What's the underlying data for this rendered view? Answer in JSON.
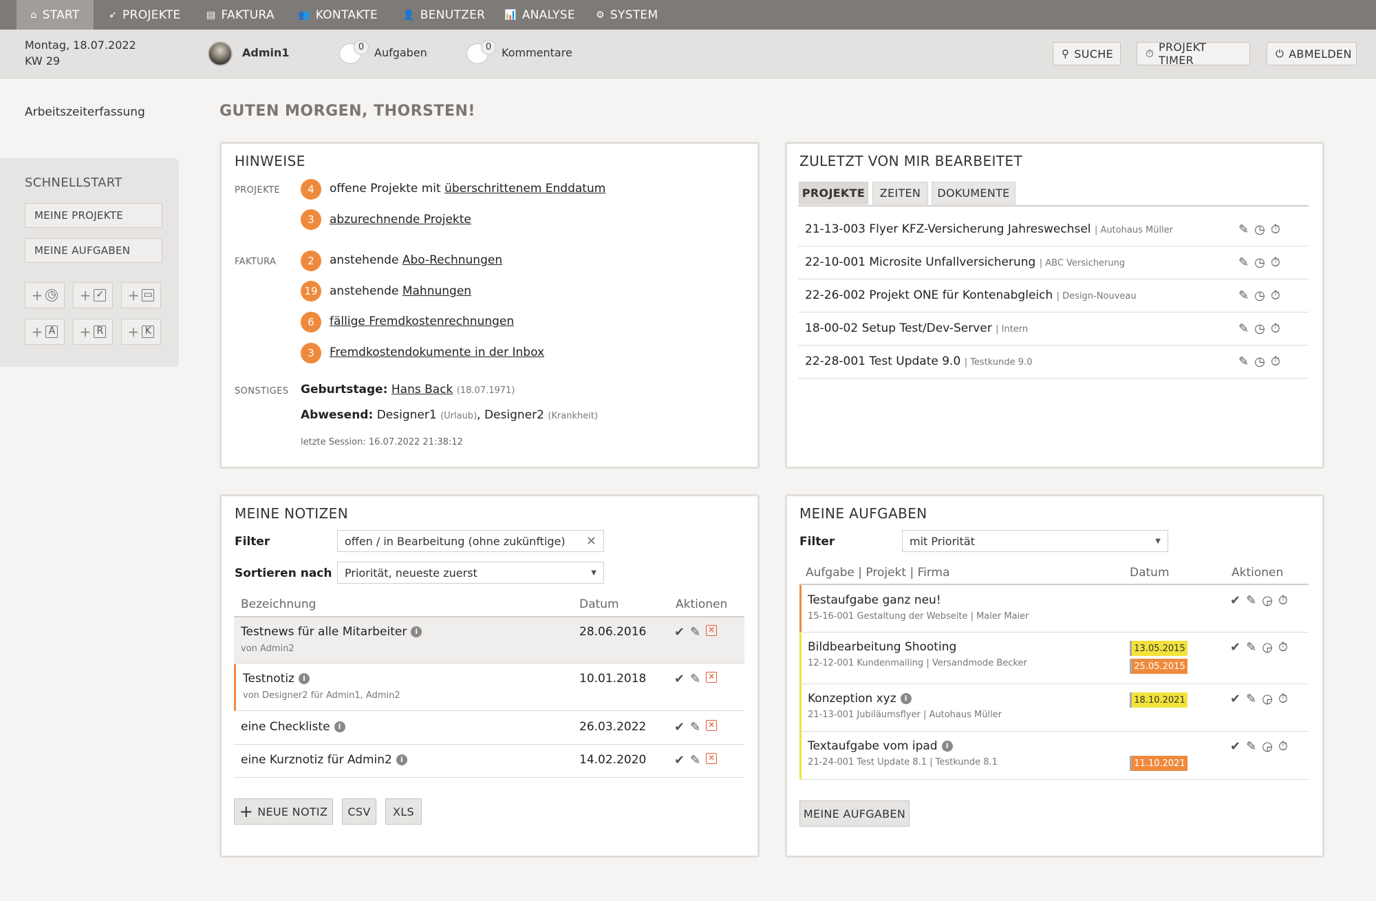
{
  "nav": {
    "items": [
      {
        "label": "START",
        "icon": "home-icon"
      },
      {
        "label": "PROJEKTE",
        "icon": "rocket-icon"
      },
      {
        "label": "FAKTURA",
        "icon": "invoice-icon"
      },
      {
        "label": "KONTAKTE",
        "icon": "people-icon"
      },
      {
        "label": "BENUTZER",
        "icon": "user-icon"
      },
      {
        "label": "ANALYSE",
        "icon": "chart-icon"
      },
      {
        "label": "SYSTEM",
        "icon": "gear-icon"
      }
    ],
    "active": "START"
  },
  "header": {
    "date": "Montag, 18.07.2022",
    "week": "KW 29",
    "user": "Admin1",
    "tasks": {
      "count": "0",
      "label": "Aufgaben"
    },
    "comments": {
      "count": "0",
      "label": "Kommentare"
    },
    "search_label": "SUCHE",
    "timer_label": "PROJEKT TIMER",
    "logout_label": "ABMELDEN"
  },
  "sidebar": {
    "link": "Arbeitszeiterfassung",
    "quickstart_title": "SCHNELLSTART",
    "my_projects": "MEINE PROJEKTE",
    "my_tasks": "MEINE AUFGABEN",
    "quick_icons": [
      {
        "name": "add-time-icon",
        "sym": "🕑"
      },
      {
        "name": "add-task-icon",
        "sym": "☑"
      },
      {
        "name": "add-folder-icon",
        "sym": "🗀"
      },
      {
        "name": "add-a-icon",
        "sym": "A"
      },
      {
        "name": "add-r-icon",
        "sym": "R"
      },
      {
        "name": "add-k-icon",
        "sym": "K"
      }
    ]
  },
  "greeting": "GUTEN MORGEN, THORSTEN!",
  "hinweise": {
    "title": "HINWEISE",
    "projekte_label": "PROJEKTE",
    "faktura_label": "FAKTURA",
    "sonstiges_label": "SONSTIGES",
    "items": [
      {
        "count": "4",
        "pre": "offene Projekte mit ",
        "link": "überschrittenem Enddatum"
      },
      {
        "count": "3",
        "pre": "",
        "link": "abzurechnende Projekte"
      },
      {
        "count": "2",
        "pre": "anstehende ",
        "link": "Abo-Rechnungen"
      },
      {
        "count": "19",
        "pre": "anstehende ",
        "link": "Mahnungen"
      },
      {
        "count": "6",
        "pre": "",
        "link": "fällige Fremdkostenrechnungen"
      },
      {
        "count": "3",
        "pre": "",
        "link": "Fremdkostendokumente in der Inbox"
      }
    ],
    "birthday_label": "Geburtstage:",
    "birthday_name": "Hans Back",
    "birthday_date": "(18.07.1971)",
    "absent_label": "Abwesend:",
    "absent_1": "Designer1",
    "absent_1_reason": "(Urlaub)",
    "absent_2": "Designer2",
    "absent_2_reason": "(Krankheit)",
    "last_session": "letzte Session: 16.07.2022 21:38:12"
  },
  "recent": {
    "title": "ZULETZT VON MIR BEARBEITET",
    "tabs": [
      "PROJEKTE",
      "ZEITEN",
      "DOKUMENTE"
    ],
    "rows": [
      {
        "name": "21-13-003 Flyer KFZ-Versicherung Jahreswechsel",
        "client": "| Autohaus Müller"
      },
      {
        "name": "22-10-001 Microsite Unfallversicherung",
        "client": "| ABC Versicherung"
      },
      {
        "name": "22-26-002 Projekt ONE für Kontenabgleich",
        "client": "| Design-Nouveau"
      },
      {
        "name": "18-00-02 Setup Test/Dev-Server",
        "client": "| Intern"
      },
      {
        "name": "22-28-001 Test Update 9.0",
        "client": "| Testkunde 9.0"
      }
    ]
  },
  "notes": {
    "title": "MEINE NOTIZEN",
    "filter_label": "Filter",
    "filter_value": "offen / in Bearbeitung (ohne zukünftige)",
    "sort_label": "Sortieren nach",
    "sort_value": "Priorität, neueste zuerst",
    "col_name": "Bezeichnung",
    "col_date": "Datum",
    "col_actions": "Aktionen",
    "rows": [
      {
        "title": "Testnews für alle Mitarbeiter",
        "sub": "von Admin2",
        "date": "28.06.2016"
      },
      {
        "title": "Testnotiz",
        "sub": "von Designer2 für Admin1, Admin2",
        "date": "10.01.2018"
      },
      {
        "title": "eine Checkliste",
        "sub": "",
        "date": "26.03.2022"
      },
      {
        "title": "eine Kurznotiz für Admin2",
        "sub": "",
        "date": "14.02.2020"
      }
    ],
    "new_label": "NEUE NOTIZ",
    "csv_label": "CSV",
    "xls_label": "XLS"
  },
  "tasks": {
    "title": "MEINE AUFGABEN",
    "filter_label": "Filter",
    "filter_value": "mit Priorität",
    "col_task": "Aufgabe | Projekt | Firma",
    "col_date": "Datum",
    "col_actions": "Aktionen",
    "rows": [
      {
        "title": "Testaufgabe ganz neu!",
        "sub": "15-16-001 Gestaltung der Webseite | Maler Maier",
        "bar": "#ef8a3c",
        "dates": []
      },
      {
        "title": "Bildbearbeitung Shooting",
        "sub": "12-12-001 Kundenmailing | Versandmode Becker",
        "bar": "#f2e23a",
        "dates": [
          "13.05.2015",
          "25.05.2015"
        ]
      },
      {
        "title": "Konzeption xyz",
        "sub": "21-13-001 Jubiläumsflyer | Autohaus Müller",
        "bar": "#f2e23a",
        "dates": [
          "18.10.2021"
        ]
      },
      {
        "title": "Textaufgabe vom ipad",
        "sub": "21-24-001 Test Update 8.1 | Testkunde 8.1",
        "bar": "#f2e23a",
        "dates": [
          "11.10.2021"
        ]
      }
    ],
    "button": "MEINE AUFGABEN"
  },
  "colors": {
    "accent_orange": "#ef8a3c",
    "accent_yellow": "#f2e23a",
    "nav_bg": "#7e7a77"
  }
}
